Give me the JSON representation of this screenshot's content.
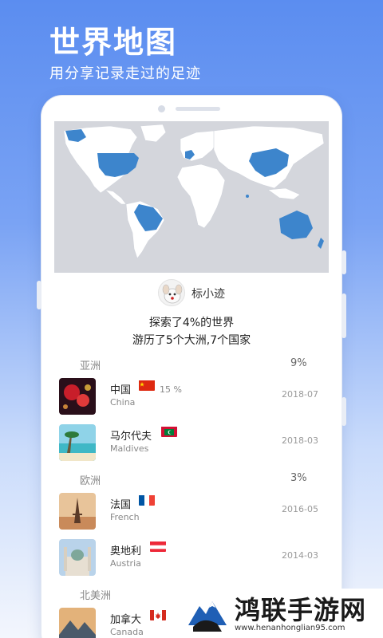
{
  "hero": {
    "title": "世界地图",
    "subtitle": "用分享记录走过的足迹"
  },
  "colors": {
    "visited": "#3d85cc",
    "land": "#ffffff",
    "sea": "#d4d6dc",
    "accent": "#5b8df0"
  },
  "profile": {
    "username": "标小迹",
    "stat_line_1": "探索了4%的世界",
    "stat_line_2": "游历了5个大洲,7个国家"
  },
  "continents": [
    {
      "name": "亚洲",
      "percent": "9%",
      "countries": [
        {
          "name_cn": "中国",
          "name_en": "China",
          "share": "15 %",
          "date": "2018-07",
          "flag": "china-flag",
          "thumb": "lanterns-photo"
        },
        {
          "name_cn": "马尔代夫",
          "name_en": "Maldives",
          "share": "",
          "date": "2018-03",
          "flag": "maldives-flag",
          "thumb": "beach-photo"
        }
      ]
    },
    {
      "name": "欧洲",
      "percent": "3%",
      "countries": [
        {
          "name_cn": "法国",
          "name_en": "French",
          "share": "",
          "date": "2016-05",
          "flag": "france-flag",
          "thumb": "eiffel-photo"
        },
        {
          "name_cn": "奥地利",
          "name_en": "Austria",
          "share": "",
          "date": "2014-03",
          "flag": "austria-flag",
          "thumb": "church-photo"
        }
      ]
    },
    {
      "name": "北美洲",
      "percent": "",
      "countries": [
        {
          "name_cn": "加拿大",
          "name_en": "Canada",
          "share": "",
          "date": "",
          "flag": "canada-flag",
          "thumb": "mountain-photo"
        }
      ]
    }
  ],
  "watermark": {
    "name": "鸿联手游网",
    "url": "www.henanhonglian95.com"
  }
}
